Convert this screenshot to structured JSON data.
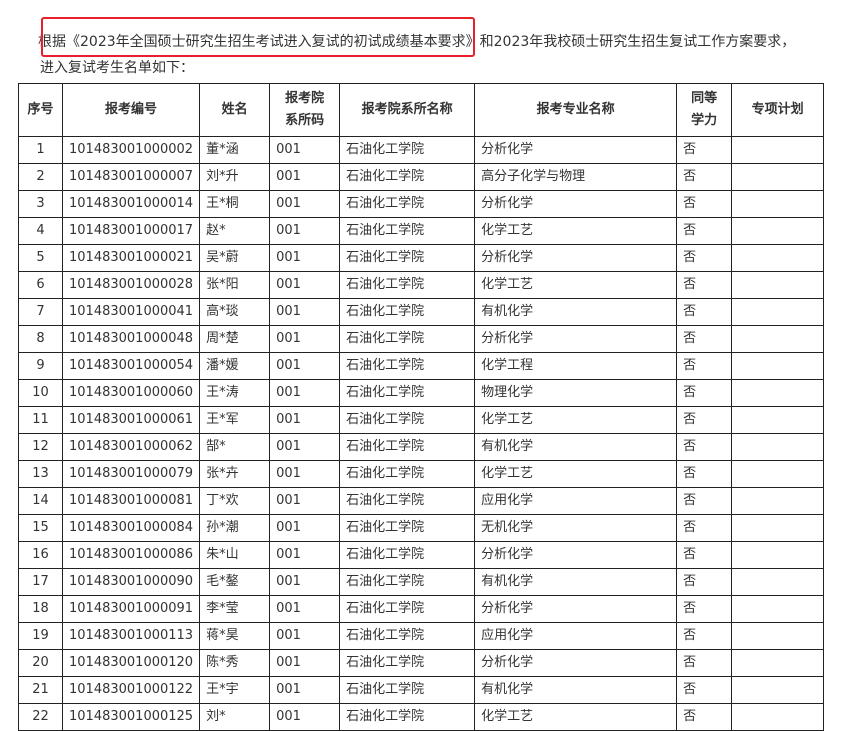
{
  "intro": {
    "prefix": "根据",
    "quoted": "《2023年全国硕士研究生招生考试进入复试的初试成绩基本要求》",
    "suffix": "和2023年我校硕士研究生招生复试工作方案要求，",
    "line2": "进入复试考生名单如下："
  },
  "table": {
    "headers": {
      "idx": "序号",
      "exam_no": "报考编号",
      "name": "姓名",
      "dept_code_l1": "报考院",
      "dept_code_l2": "系所码",
      "dept_name": "报考院系所名称",
      "major": "报考专业名称",
      "equiv_l1": "同等",
      "equiv_l2": "学力",
      "plan": "专项计划"
    },
    "rows": [
      {
        "idx": "1",
        "exam_no": "101483001000002",
        "name": "董*涵",
        "code": "001",
        "dept": "石油化工学院",
        "major": "分析化学",
        "equiv": "否",
        "plan": ""
      },
      {
        "idx": "2",
        "exam_no": "101483001000007",
        "name": "刘*升",
        "code": "001",
        "dept": "石油化工学院",
        "major": "高分子化学与物理",
        "equiv": "否",
        "plan": ""
      },
      {
        "idx": "3",
        "exam_no": "101483001000014",
        "name": "王*桐",
        "code": "001",
        "dept": "石油化工学院",
        "major": "分析化学",
        "equiv": "否",
        "plan": ""
      },
      {
        "idx": "4",
        "exam_no": "101483001000017",
        "name": "赵*",
        "code": "001",
        "dept": "石油化工学院",
        "major": "化学工艺",
        "equiv": "否",
        "plan": ""
      },
      {
        "idx": "5",
        "exam_no": "101483001000021",
        "name": "吴*蔚",
        "code": "001",
        "dept": "石油化工学院",
        "major": "分析化学",
        "equiv": "否",
        "plan": ""
      },
      {
        "idx": "6",
        "exam_no": "101483001000028",
        "name": "张*阳",
        "code": "001",
        "dept": "石油化工学院",
        "major": "化学工艺",
        "equiv": "否",
        "plan": ""
      },
      {
        "idx": "7",
        "exam_no": "101483001000041",
        "name": "高*琰",
        "code": "001",
        "dept": "石油化工学院",
        "major": "有机化学",
        "equiv": "否",
        "plan": ""
      },
      {
        "idx": "8",
        "exam_no": "101483001000048",
        "name": "周*楚",
        "code": "001",
        "dept": "石油化工学院",
        "major": "分析化学",
        "equiv": "否",
        "plan": ""
      },
      {
        "idx": "9",
        "exam_no": "101483001000054",
        "name": "潘*媛",
        "code": "001",
        "dept": "石油化工学院",
        "major": "化学工程",
        "equiv": "否",
        "plan": ""
      },
      {
        "idx": "10",
        "exam_no": "101483001000060",
        "name": "王*涛",
        "code": "001",
        "dept": "石油化工学院",
        "major": "物理化学",
        "equiv": "否",
        "plan": ""
      },
      {
        "idx": "11",
        "exam_no": "101483001000061",
        "name": "王*军",
        "code": "001",
        "dept": "石油化工学院",
        "major": "化学工艺",
        "equiv": "否",
        "plan": ""
      },
      {
        "idx": "12",
        "exam_no": "101483001000062",
        "name": "郜*",
        "code": "001",
        "dept": "石油化工学院",
        "major": "有机化学",
        "equiv": "否",
        "plan": ""
      },
      {
        "idx": "13",
        "exam_no": "101483001000079",
        "name": "张*卉",
        "code": "001",
        "dept": "石油化工学院",
        "major": "化学工艺",
        "equiv": "否",
        "plan": ""
      },
      {
        "idx": "14",
        "exam_no": "101483001000081",
        "name": "丁*欢",
        "code": "001",
        "dept": "石油化工学院",
        "major": "应用化学",
        "equiv": "否",
        "plan": ""
      },
      {
        "idx": "15",
        "exam_no": "101483001000084",
        "name": "孙*潮",
        "code": "001",
        "dept": "石油化工学院",
        "major": "无机化学",
        "equiv": "否",
        "plan": ""
      },
      {
        "idx": "16",
        "exam_no": "101483001000086",
        "name": "朱*山",
        "code": "001",
        "dept": "石油化工学院",
        "major": "分析化学",
        "equiv": "否",
        "plan": ""
      },
      {
        "idx": "17",
        "exam_no": "101483001000090",
        "name": "毛*鏊",
        "code": "001",
        "dept": "石油化工学院",
        "major": "有机化学",
        "equiv": "否",
        "plan": ""
      },
      {
        "idx": "18",
        "exam_no": "101483001000091",
        "name": "李*莹",
        "code": "001",
        "dept": "石油化工学院",
        "major": "分析化学",
        "equiv": "否",
        "plan": ""
      },
      {
        "idx": "19",
        "exam_no": "101483001000113",
        "name": "蒋*昊",
        "code": "001",
        "dept": "石油化工学院",
        "major": "应用化学",
        "equiv": "否",
        "plan": ""
      },
      {
        "idx": "20",
        "exam_no": "101483001000120",
        "name": "陈*秀",
        "code": "001",
        "dept": "石油化工学院",
        "major": "分析化学",
        "equiv": "否",
        "plan": ""
      },
      {
        "idx": "21",
        "exam_no": "101483001000122",
        "name": "王*宇",
        "code": "001",
        "dept": "石油化工学院",
        "major": "有机化学",
        "equiv": "否",
        "plan": ""
      },
      {
        "idx": "22",
        "exam_no": "101483001000125",
        "name": "刘*",
        "code": "001",
        "dept": "石油化工学院",
        "major": "化学工艺",
        "equiv": "否",
        "plan": ""
      }
    ]
  },
  "colors": {
    "highlight_border": "#e8202a",
    "table_border": "#222222",
    "text": "#333333"
  }
}
